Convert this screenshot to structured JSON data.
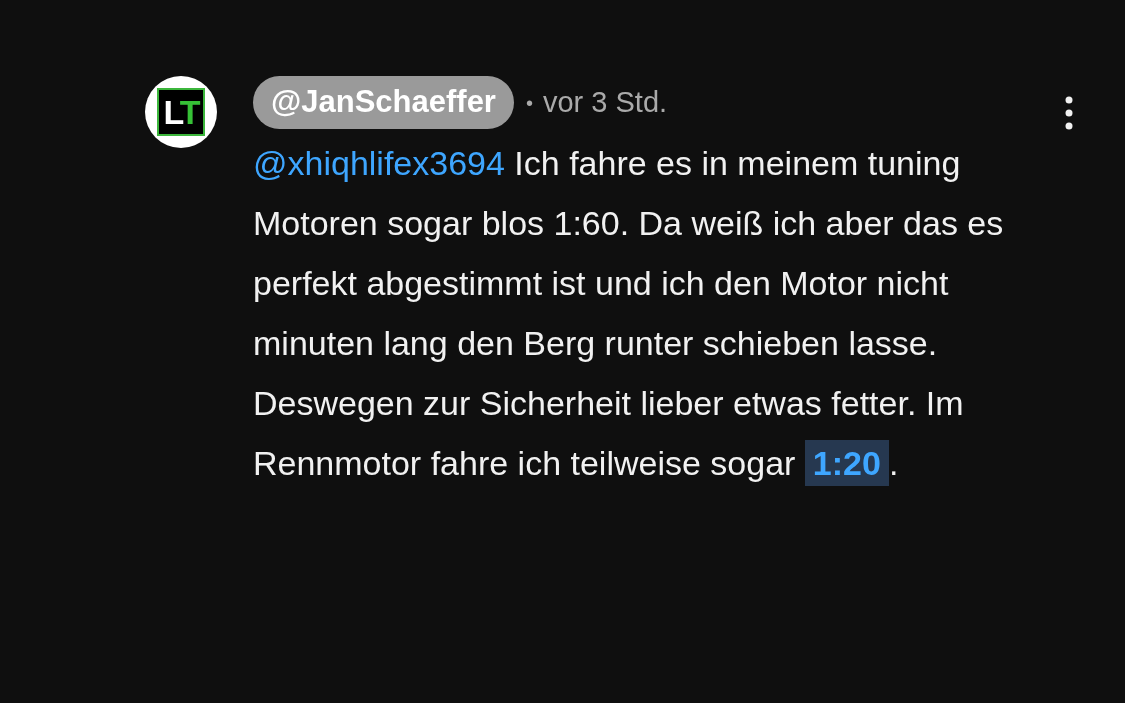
{
  "comment": {
    "avatar": {
      "logo_letters": [
        "L",
        "T"
      ]
    },
    "author": "@JanSchaeffer",
    "separator": "•",
    "time": "vor 3 Std.",
    "body": [
      {
        "kind": "mention",
        "text": "@xhiqhlifex3694"
      },
      {
        "kind": "text",
        "text": " Ich fahre es in meinem tuning Motoren sogar blos 1:60. Da weiß ich aber das es perfekt abgestimmt ist und ich den Motor nicht minuten lang den Berg runter schieben lasse. Deswegen zur Sicherheit lieber etwas fetter. Im Rennmotor fahre ich teilweise sogar "
      },
      {
        "kind": "timestamp",
        "text": "1:20"
      },
      {
        "kind": "text",
        "text": "."
      }
    ]
  }
}
